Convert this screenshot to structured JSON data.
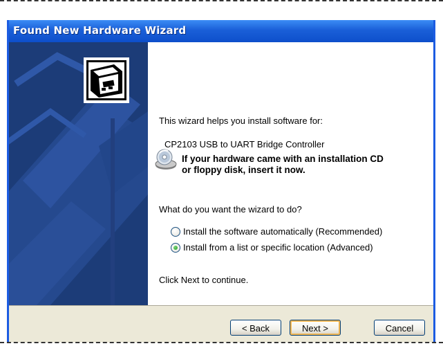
{
  "window": {
    "title": "Found New Hardware Wizard"
  },
  "content": {
    "intro": "This wizard helps you install software for:",
    "device_name": "CP2103 USB to UART Bridge Controller",
    "cd_notice_line1": "If your hardware came with an installation CD",
    "cd_notice_line2": "or floppy disk, insert it now.",
    "question": "What do you want the wizard to do?",
    "options": [
      {
        "label": "Install the software automatically (Recommended)",
        "selected": false
      },
      {
        "label": "Install from a list or specific location (Advanced)",
        "selected": true
      }
    ],
    "continue_text": "Click Next to continue."
  },
  "buttons": {
    "back": "< Back",
    "next": "Next >",
    "cancel": "Cancel"
  },
  "icons": {
    "hardware": "hardware-wizard-icon",
    "cd": "cd-drive-icon"
  },
  "colors": {
    "titlebar": "#1a5fd8",
    "left_panel": "#1c3c78",
    "dialog_bg": "#ece9d8",
    "radio_selected": "#21a121"
  }
}
